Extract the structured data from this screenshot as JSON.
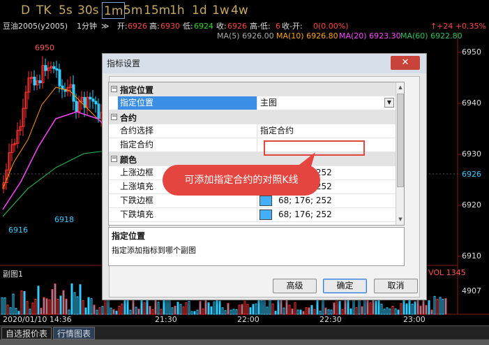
{
  "toolbar": {
    "timeframes": [
      "D",
      "TK",
      "5s",
      "30s",
      "1m",
      "5m",
      "15m",
      "1h",
      "1d",
      "1w",
      "4w"
    ],
    "active": "1m"
  },
  "quote": {
    "instrument": "豆油2005(y2005)",
    "period": "1分钟",
    "open_label": "开:",
    "open": "6926",
    "high_label": "高:",
    "high": "6930",
    "low_label": "低:",
    "low": "6924",
    "close_label": "收:",
    "close": "6926",
    "range_label": "高-低:",
    "range": "6",
    "change_label": "收-开:",
    "change": "0(0.00%)",
    "right": "↑+24 +0.35%"
  },
  "ma": {
    "ma5": "MA(5) 6926.00",
    "ma10": "MA(10) 6926.80",
    "ma20": "MA(20) 6923.30",
    "ma60": "MA(60) 6922.80"
  },
  "price_axis": [
    "6950",
    "6940",
    "6930",
    "6926",
    "6920",
    "6910",
    "4907"
  ],
  "chart_annotations": {
    "high_mark": "6950",
    "low_mark_1": "6918",
    "low_mark_2": "6916",
    "sub_chart": "副图1",
    "vol_label": "VOL 1345"
  },
  "time_axis": [
    "2020/01/10 14:36",
    "21:30",
    "22:00",
    "22:30",
    "23:00"
  ],
  "tabs": [
    "自选报价表",
    "行情图表"
  ],
  "colors": {
    "ma5": "#cccccc",
    "ma10": "#ffa500",
    "ma20": "#ff44ff",
    "ma60": "#22c55e",
    "up": "#ff3333",
    "down": "#33ccff",
    "accent": "#e5453f"
  },
  "dialog": {
    "title": "指标设置",
    "close": "✕",
    "sections": [
      {
        "label": "指定位置",
        "rows": [
          {
            "name": "指定位置",
            "value": "主图",
            "selected": true
          }
        ]
      },
      {
        "label": "合约",
        "rows": [
          {
            "name": "合约选择",
            "value": "指定合约"
          },
          {
            "name": "指定合约",
            "value": ""
          }
        ]
      },
      {
        "label": "颜色",
        "rows": [
          {
            "name": "上涨边框",
            "value": "68; 176; 252"
          },
          {
            "name": "上涨填充",
            "value": "68; 176; 252"
          },
          {
            "name": "下跌边框",
            "value": "68; 176; 252"
          },
          {
            "name": "下跌填充",
            "value": "68; 176; 252"
          }
        ]
      }
    ],
    "description_title": "指定位置",
    "description_text": "指定添加指标到哪个副图",
    "buttons": {
      "advanced": "高级",
      "ok": "确定",
      "cancel": "取消"
    }
  },
  "callout": "可添加指定合约的对照K线"
}
